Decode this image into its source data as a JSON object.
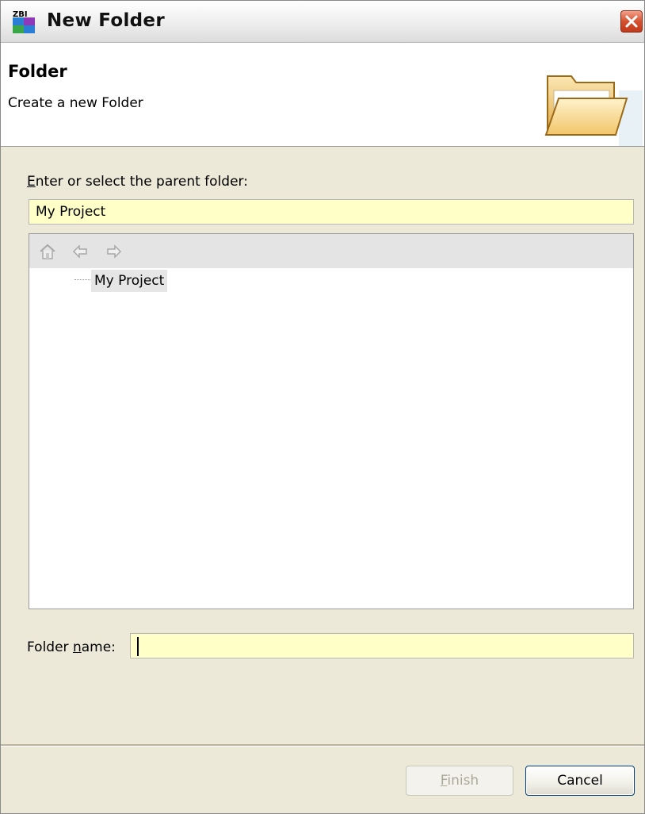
{
  "window": {
    "title": "New Folder",
    "app_icon_text": "ZBI"
  },
  "header": {
    "title": "Folder",
    "description": "Create a new Folder"
  },
  "parent": {
    "label_mnemonic": "E",
    "label_rest": "nter or select the parent folder:",
    "value": "My Project"
  },
  "tree": {
    "toolbar": [
      "home-icon",
      "back-arrow-icon",
      "forward-arrow-icon"
    ],
    "items": [
      {
        "label": "My Project",
        "icon": "open-folder-icon",
        "selected": true
      }
    ]
  },
  "folder_name": {
    "label_before": "Folder ",
    "label_mnemonic": "n",
    "label_after": "ame:",
    "value": ""
  },
  "buttons": {
    "finish_mnemonic": "F",
    "finish_rest": "inish",
    "finish_enabled": false,
    "cancel": "Cancel"
  },
  "colors": {
    "input_bg": "#ffffc8",
    "dialog_bg": "#ece9d8",
    "close_button": "#d4512e"
  }
}
